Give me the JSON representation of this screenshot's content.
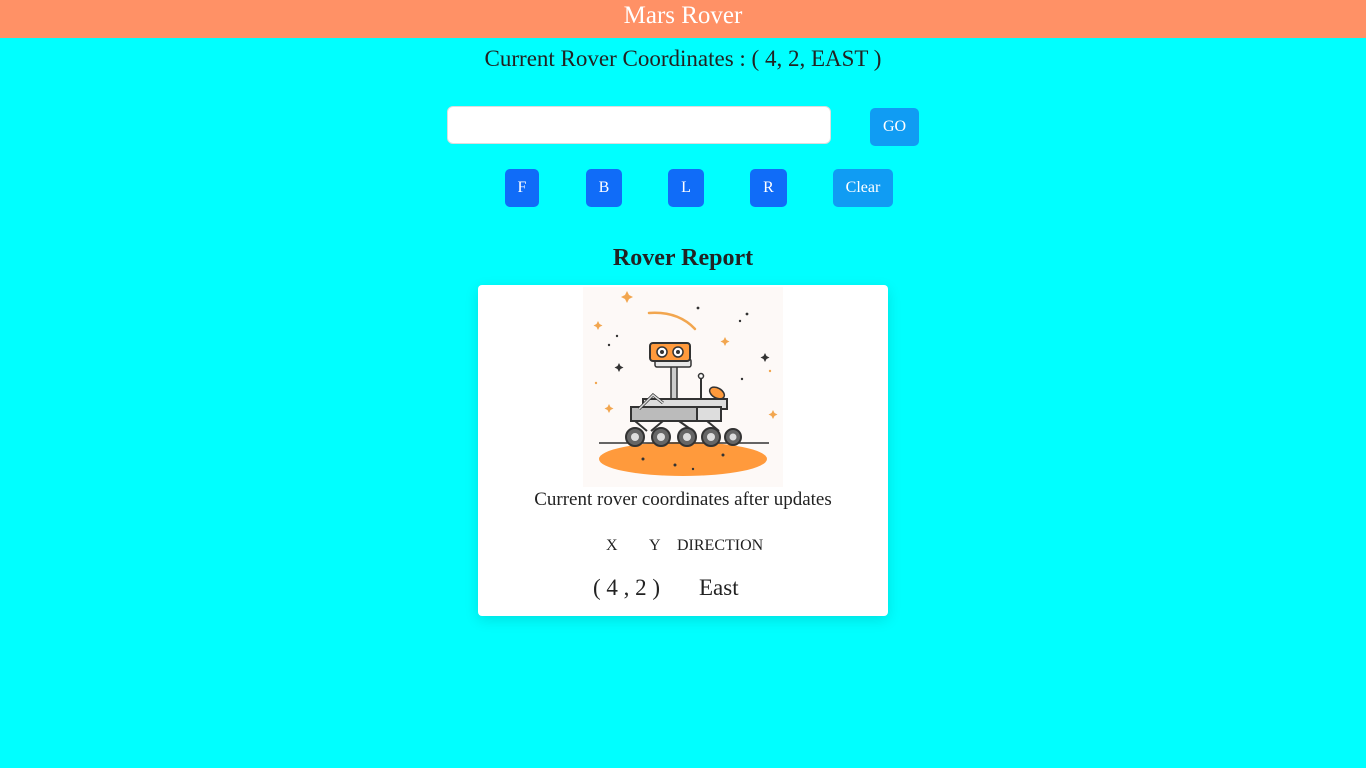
{
  "header": {
    "title": "Mars Rover"
  },
  "status": {
    "coordinates_text": "Current Rover Coordinates : ( 4, 2, EAST )"
  },
  "controls": {
    "command_input_value": "",
    "command_input_placeholder": "",
    "go_label": "GO",
    "forward_label": "F",
    "backward_label": "B",
    "left_label": "L",
    "right_label": "R",
    "clear_label": "Clear"
  },
  "report": {
    "title": "Rover Report",
    "image_icon": "mars-rover-illustration",
    "caption": "Current rover coordinates after updates",
    "columns": {
      "x": "X",
      "y": "Y",
      "direction": "DIRECTION"
    },
    "values": {
      "xy": "( 4 ,  2 )",
      "direction": "East"
    }
  },
  "colors": {
    "background": "#00ffff",
    "header": "#ff9166",
    "go_button": "#109cf3",
    "command_button": "#106cf8",
    "clear_button": "#109cf3",
    "rover_orange": "#ff9a3c"
  }
}
